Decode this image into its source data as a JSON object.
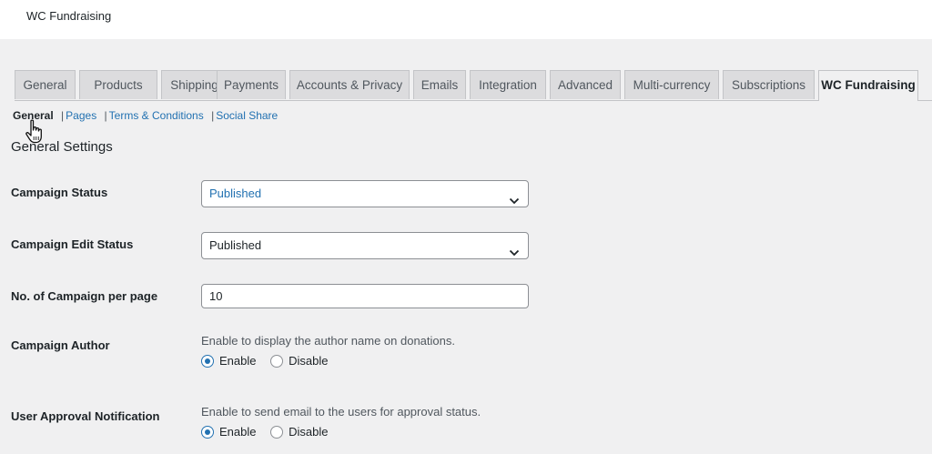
{
  "app": {
    "title": "WC Fundraising"
  },
  "tabs": [
    {
      "label": "General"
    },
    {
      "label": "Products"
    },
    {
      "label": "Shipping"
    },
    {
      "label": "Payments"
    },
    {
      "label": "Accounts & Privacy"
    },
    {
      "label": "Emails"
    },
    {
      "label": "Integration"
    },
    {
      "label": "Advanced"
    },
    {
      "label": "Multi-currency"
    },
    {
      "label": "Subscriptions"
    },
    {
      "label": "WC Fundraising",
      "active": true
    }
  ],
  "subnav": {
    "current": "General",
    "links": [
      "Pages",
      "Terms & Conditions",
      "Social Share"
    ],
    "separator": "|"
  },
  "section": {
    "title": "General Settings"
  },
  "fields": {
    "campaign_status": {
      "label": "Campaign Status",
      "value": "Published"
    },
    "campaign_edit_status": {
      "label": "Campaign Edit Status",
      "value": "Published"
    },
    "campaigns_per_page": {
      "label": "No. of Campaign per page",
      "value": "10"
    },
    "campaign_author": {
      "label": "Campaign Author",
      "description": "Enable to display the author name on donations.",
      "options": [
        "Enable",
        "Disable"
      ],
      "selected": "Enable"
    },
    "user_approval": {
      "label": "User Approval Notification",
      "description": "Enable to send email to the users for approval status.",
      "options": [
        "Enable",
        "Disable"
      ],
      "selected": "Enable"
    }
  },
  "colors": {
    "link": "#2271b1",
    "accent": "#2271b1",
    "background": "#f0f0f1"
  }
}
